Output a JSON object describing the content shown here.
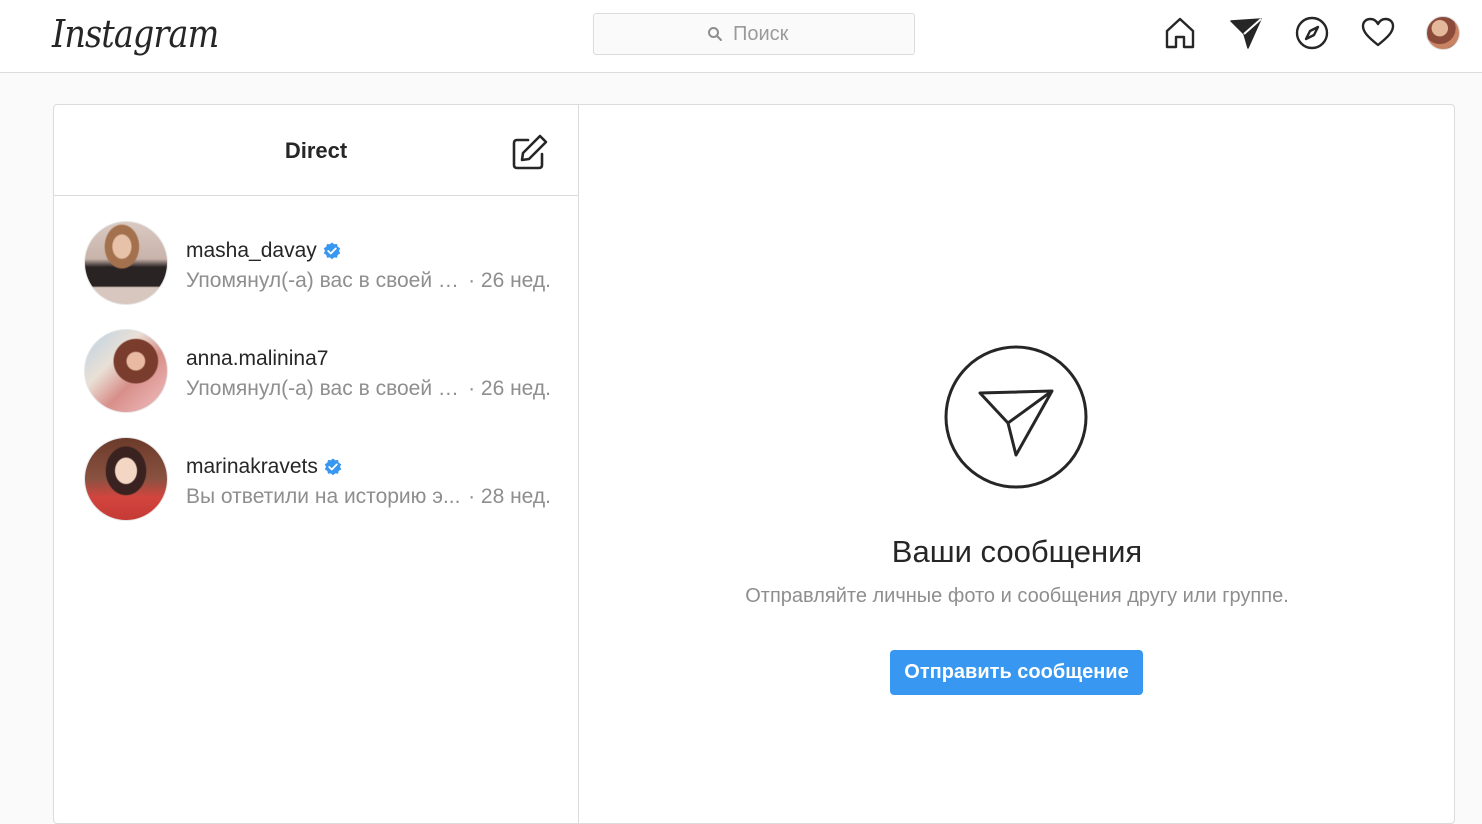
{
  "app": {
    "logo_text": "Instagram"
  },
  "search": {
    "placeholder": "Поиск"
  },
  "nav": {
    "icons": [
      "home-icon",
      "direct-icon",
      "explore-icon",
      "activity-icon",
      "profile-avatar"
    ]
  },
  "direct": {
    "title": "Direct",
    "threads": [
      {
        "username": "masha_davay",
        "verified": true,
        "preview": "Упомянул(-а) вас в своей и...",
        "time": "· 26 нед."
      },
      {
        "username": "anna.malinina7",
        "verified": false,
        "preview": "Упомянул(-а) вас в своей и...",
        "time": "· 26 нед."
      },
      {
        "username": "marinakravets",
        "verified": true,
        "preview": "Вы ответили на историю э...",
        "time": "· 28 нед."
      }
    ]
  },
  "empty_state": {
    "title": "Ваши сообщения",
    "subtitle": "Отправляйте личные фото и сообщения другу или группе.",
    "button_label": "Отправить сообщение"
  },
  "colors": {
    "accent": "#3897f0",
    "verified": "#3897f0",
    "border": "#dbdbdb",
    "muted_text": "#8e8e8e"
  }
}
